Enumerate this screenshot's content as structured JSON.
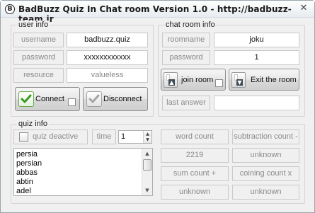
{
  "window": {
    "title": "BadBuzz Quiz In Chat room Version 1.0 - http://badbuzz-team.ir",
    "app_icon_glyph": "B",
    "close_glyph": "✕"
  },
  "user_info": {
    "legend": "user info",
    "username_label": "username",
    "username_value": "badbuzz.quiz",
    "password_label": "password",
    "password_value": "xxxxxxxxxxxx",
    "resource_label": "resource",
    "resource_value": "valueless",
    "connect_label": "Connect",
    "disconnect_label": "Disconnect"
  },
  "chat_room_info": {
    "legend": "chat room info",
    "roomname_label": "roomname",
    "roomname_value": "joku",
    "password_label": "password",
    "password_value": "1",
    "join_label": "join room",
    "exit_label": "Exit the room",
    "last_answer_label": "last answer",
    "last_answer_value": ""
  },
  "quiz_info": {
    "legend": "quiz info",
    "deactive_label": "quiz deactive",
    "time_label": "time",
    "time_value": "1",
    "words": [
      "persia",
      "persian",
      "abbas",
      "abtin",
      "adel"
    ],
    "word_count_label": "word count",
    "word_count_value": "2219",
    "subtraction_label": "subtraction count -",
    "subtraction_value": "unknown",
    "sum_label": "sum count +",
    "sum_value": "unknown",
    "coining_label": "coining count x",
    "coining_value": "unknown"
  },
  "icons": {
    "check": "check-icon",
    "join": "arrow-up-icon",
    "exit": "arrow-down-icon"
  },
  "colors": {
    "check_active": "#3c9a1e",
    "check_inactive": "#a5a5a5",
    "window_bg": "#f0f0f0"
  }
}
